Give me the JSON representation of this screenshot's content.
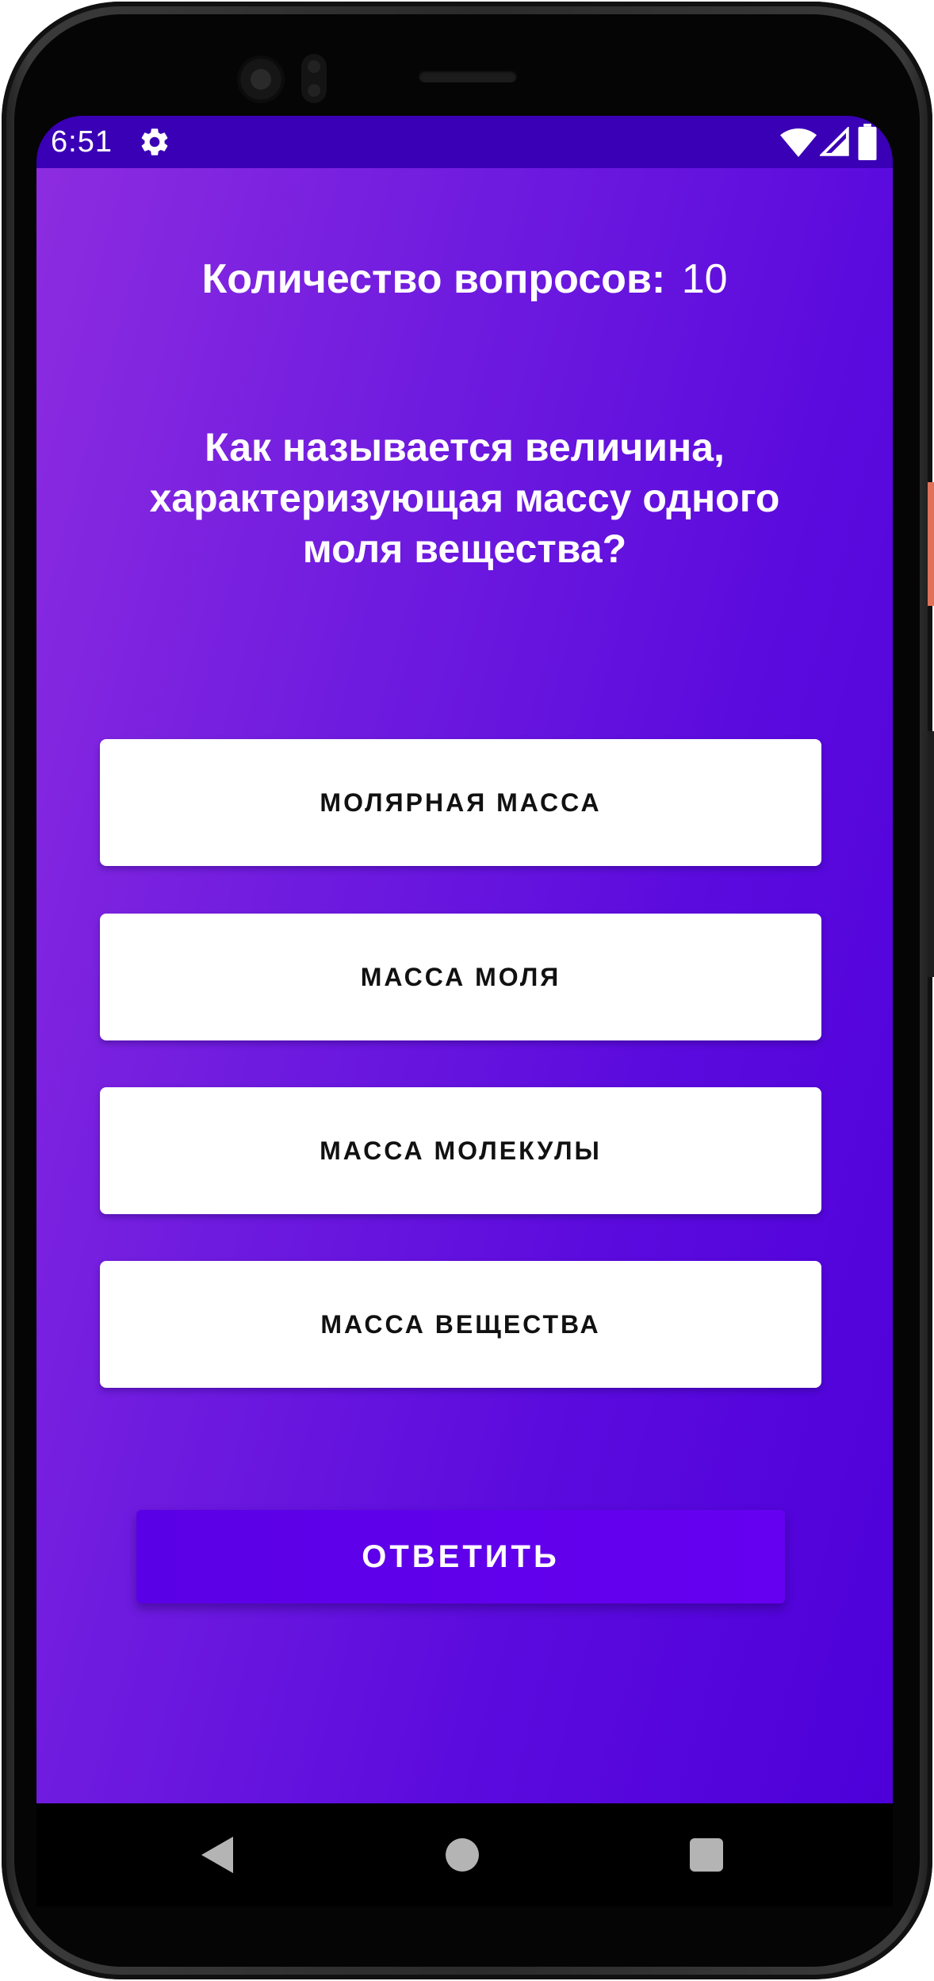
{
  "status_bar": {
    "time": "6:51",
    "icons": [
      "gear-icon",
      "wifi-icon",
      "signal-icon",
      "battery-icon"
    ]
  },
  "quiz": {
    "question_count_label": "Количество вопросов:",
    "question_count_value": "10",
    "question": "Как называется величина, характеризующая массу одного моля вещества?",
    "answers": [
      "МОЛЯРНАЯ МАССА",
      "МАССА МОЛЯ",
      "МАССА МОЛЕКУЛЫ",
      "МАССА ВЕЩЕСТВА"
    ],
    "submit_label": "ОТВЕТИТЬ"
  },
  "navigation": {
    "icons": [
      "back-icon",
      "home-icon",
      "recents-icon"
    ]
  },
  "colors": {
    "background_gradient_start": "#8d2ce0",
    "background_gradient_end": "#4d00d9",
    "status_bar": "#3a00b5",
    "answer_background": "#ffffff",
    "submit_background": "#6000ea"
  }
}
